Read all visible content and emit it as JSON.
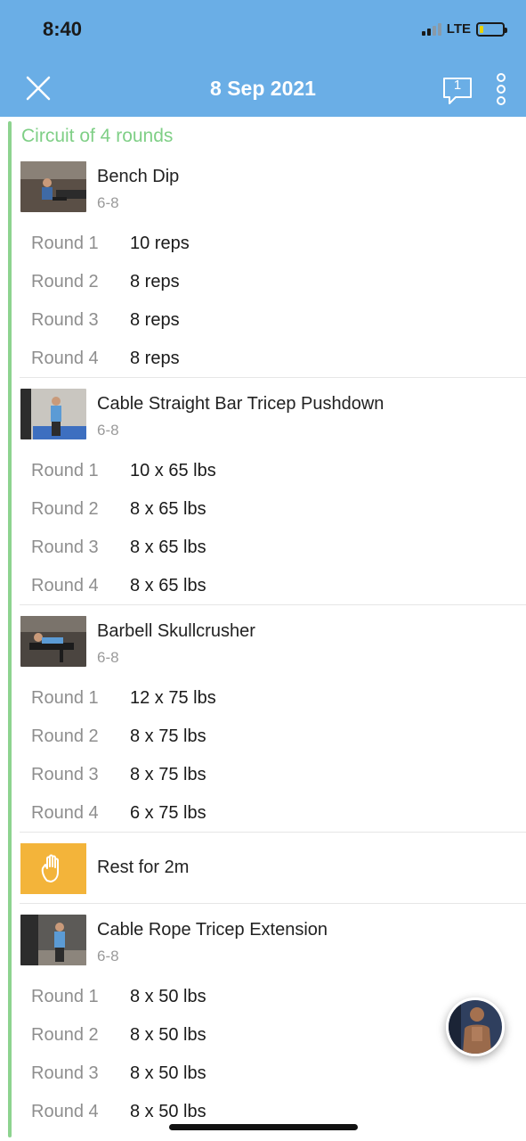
{
  "status_bar": {
    "time": "8:40",
    "network": "LTE"
  },
  "header": {
    "title": "8 Sep 2021",
    "comment_count": "1"
  },
  "circuit": {
    "title": "Circuit of 4 rounds"
  },
  "exercises": [
    {
      "name": "Bench Dip",
      "target": "6-8",
      "rounds": [
        {
          "label": "Round 1",
          "value": "10 reps"
        },
        {
          "label": "Round 2",
          "value": "8 reps"
        },
        {
          "label": "Round 3",
          "value": "8 reps"
        },
        {
          "label": "Round 4",
          "value": "8 reps"
        }
      ]
    },
    {
      "name": "Cable Straight Bar Tricep Pushdown",
      "target": "6-8",
      "rounds": [
        {
          "label": "Round 1",
          "value": "10 x 65 lbs"
        },
        {
          "label": "Round 2",
          "value": "8 x 65 lbs"
        },
        {
          "label": "Round 3",
          "value": "8 x 65 lbs"
        },
        {
          "label": "Round 4",
          "value": "8 x 65 lbs"
        }
      ]
    },
    {
      "name": "Barbell Skullcrusher",
      "target": "6-8",
      "rounds": [
        {
          "label": "Round 1",
          "value": "12 x 75 lbs"
        },
        {
          "label": "Round 2",
          "value": "8 x 75 lbs"
        },
        {
          "label": "Round 3",
          "value": "8 x 75 lbs"
        },
        {
          "label": "Round 4",
          "value": "6 x 75 lbs"
        }
      ]
    },
    {
      "name": "Cable Rope Tricep Extension",
      "target": "6-8",
      "rounds": [
        {
          "label": "Round 1",
          "value": "8 x 50 lbs"
        },
        {
          "label": "Round 2",
          "value": "8 x 50 lbs"
        },
        {
          "label": "Round 3",
          "value": "8 x 50 lbs"
        },
        {
          "label": "Round 4",
          "value": "8 x 50 lbs"
        }
      ]
    }
  ],
  "rest": {
    "label": "Rest for 2m"
  },
  "colors": {
    "header_bg": "#6aaee6",
    "circuit_accent": "#7fcf86",
    "rest_bg": "#f3b43a"
  },
  "icons": {
    "close": "close-icon",
    "comment": "comment-icon",
    "more": "more-vertical-icon",
    "rest": "hand-icon"
  }
}
